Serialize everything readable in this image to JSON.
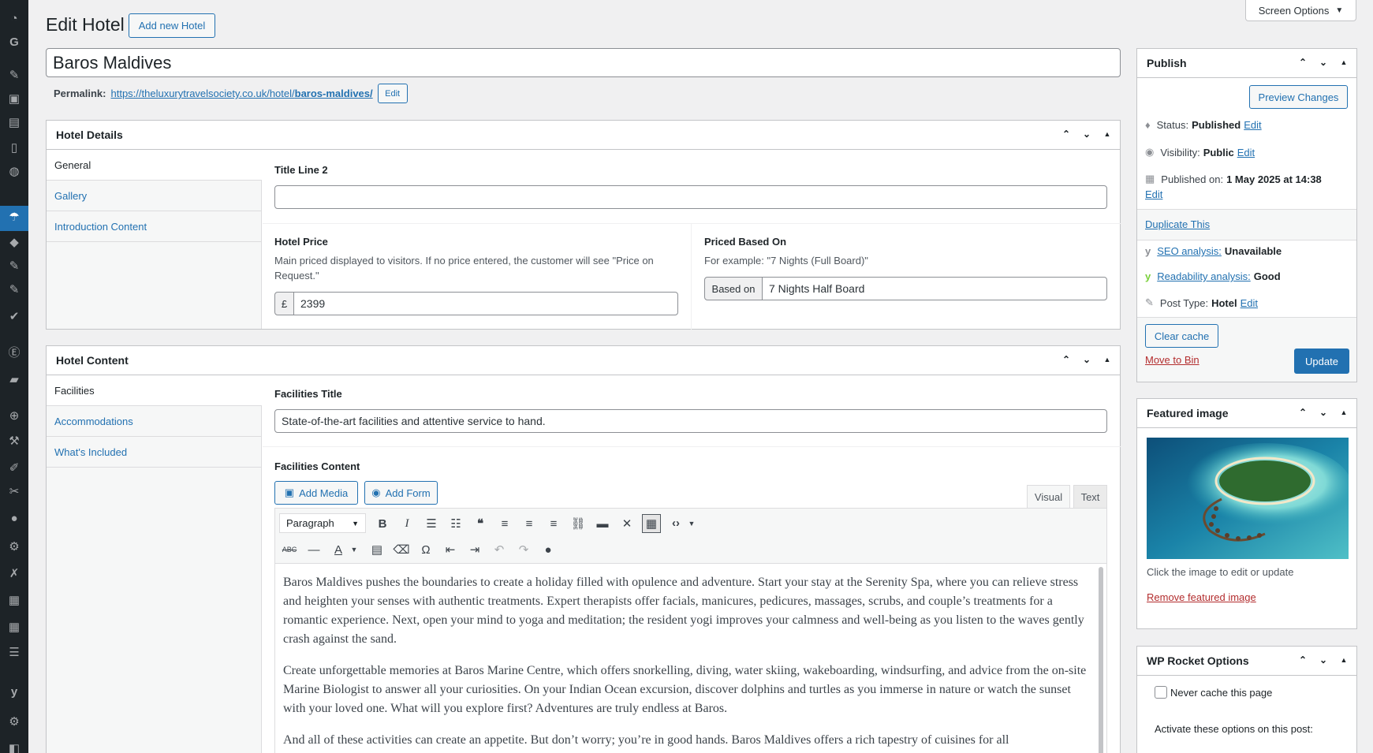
{
  "page": {
    "title": "Edit Hotel",
    "add_new_label": "Add new Hotel",
    "screen_options_label": "Screen Options"
  },
  "post": {
    "title": "Baros Maldives",
    "permalink_label": "Permalink:",
    "permalink_base": "https://theluxurytravelsociety.co.uk/hotel/",
    "permalink_slug": "baros-maldives/",
    "permalink_edit": "Edit"
  },
  "hotel_details": {
    "heading": "Hotel Details",
    "tabs": [
      "General",
      "Gallery",
      "Introduction Content"
    ],
    "title_line2_label": "Title Line 2",
    "title_line2_value": "",
    "price_label": "Hotel Price",
    "price_desc": "Main priced displayed to visitors. If no price entered, the customer will see \"Price on Request.\"",
    "currency_symbol": "£",
    "price_value": "2399",
    "priced_based_label": "Priced Based On",
    "priced_based_desc": "For example: \"7 Nights (Full Board)\"",
    "based_on_prefix": "Based on",
    "based_on_value": "7 Nights Half Board"
  },
  "hotel_content": {
    "heading": "Hotel Content",
    "tabs": [
      "Facilities",
      "Accommodations",
      "What's Included"
    ],
    "facilities_title_label": "Facilities Title",
    "facilities_title_value": "State-of-the-art facilities and attentive service to hand.",
    "facilities_content_label": "Facilities Content",
    "add_media_label": "Add Media",
    "add_form_label": "Add Form",
    "visual_tab": "Visual",
    "text_tab": "Text",
    "format_select": "Paragraph",
    "paragraphs": [
      "Baros Maldives pushes the boundaries to create a holiday filled with opulence and adventure. Start your stay at the Serenity Spa, where you can relieve stress and heighten your senses with authentic treatments. Expert therapists offer facials, manicures, pedicures, massages, scrubs, and couple’s treatments for a romantic experience. Next, open your mind to yoga and meditation; the resident yogi improves your calmness and well-being as you listen to the waves gently crash against the sand.",
      "Create unforgettable memories at Baros Marine Centre, which offers snorkelling, diving, water skiing, wakeboarding, windsurfing, and advice from the on-site Marine Biologist to answer all your curiosities. On your Indian Ocean excursion, discover dolphins and turtles as you immerse in nature or watch the sunset with your loved one. What will you explore first? Adventures are truly endless at Baros.",
      "And all of these activities can create an appetite. But don’t worry; you’re in good hands. Baros Maldives offers a rich tapestry of cuisines for all"
    ]
  },
  "publish": {
    "heading": "Publish",
    "preview_label": "Preview Changes",
    "status_label": "Status:",
    "status_value": "Published",
    "visibility_label": "Visibility:",
    "visibility_value": "Public",
    "published_label": "Published on:",
    "published_value": "1 May 2025 at 14:38",
    "edit": "Edit",
    "duplicate_label": "Duplicate This",
    "seo_label": "SEO analysis:",
    "seo_value": "Unavailable",
    "readability_label": "Readability analysis:",
    "readability_value": "Good",
    "post_type_label": "Post Type:",
    "post_type_value": "Hotel",
    "clear_cache_label": "Clear cache",
    "move_to_bin_label": "Move to Bin",
    "update_label": "Update"
  },
  "featured_image": {
    "heading": "Featured image",
    "hint": "Click the image to edit or update",
    "remove_label": "Remove featured image"
  },
  "wp_rocket": {
    "heading": "WP Rocket Options",
    "never_cache_label": "Never cache this page",
    "activate_label": "Activate these options on this post:"
  },
  "colors": {
    "accent": "#2271b1",
    "sidebar": "#1d2327",
    "danger": "#b32d2e"
  }
}
